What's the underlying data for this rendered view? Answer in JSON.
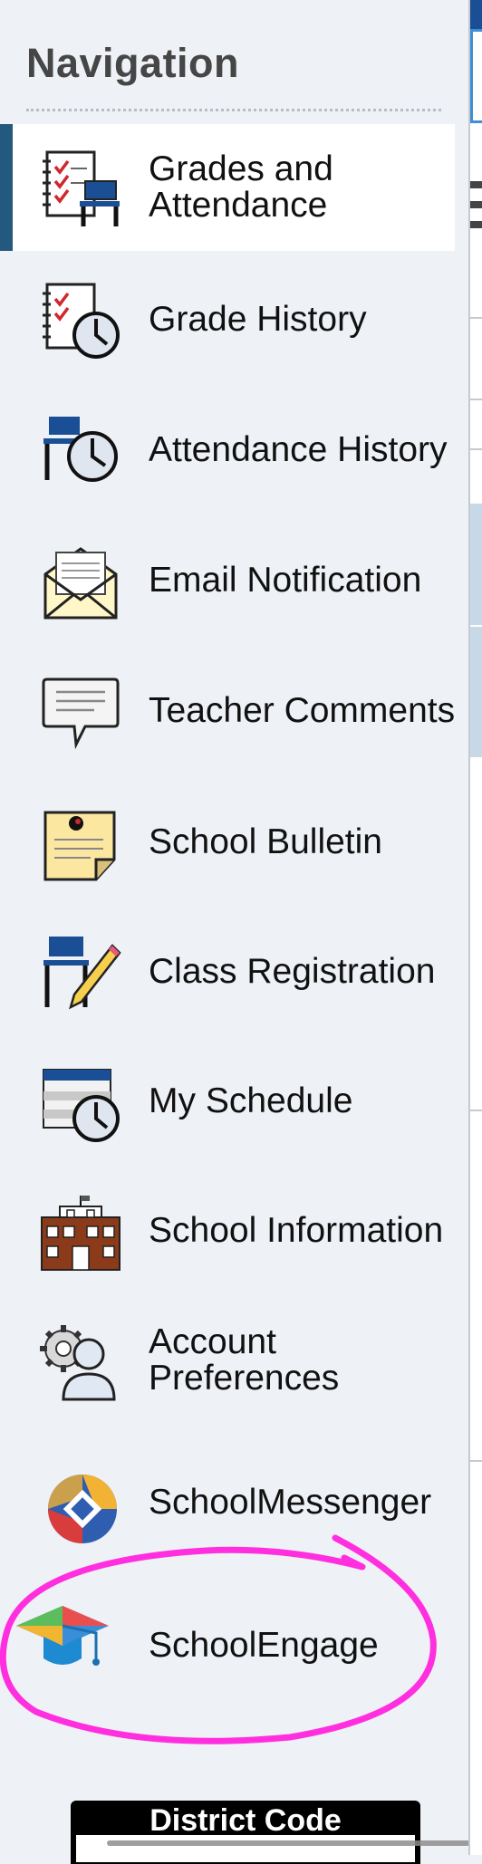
{
  "nav": {
    "title": "Navigation",
    "items": [
      {
        "label": "Grades and Attendance",
        "icon": "grades-checklist-icon"
      },
      {
        "label": "Grade History",
        "icon": "grade-history-icon"
      },
      {
        "label": "Attendance History",
        "icon": "attendance-history-icon"
      },
      {
        "label": "Email Notification",
        "icon": "email-envelope-icon"
      },
      {
        "label": "Teacher Comments",
        "icon": "speech-bubble-icon"
      },
      {
        "label": "School Bulletin",
        "icon": "bulletin-note-icon"
      },
      {
        "label": "Class Registration",
        "icon": "class-registration-icon"
      },
      {
        "label": "My Schedule",
        "icon": "schedule-calendar-icon"
      },
      {
        "label": "School Information",
        "icon": "school-building-icon"
      },
      {
        "label": "Account Preferences",
        "icon": "account-gear-icon"
      },
      {
        "label": "SchoolMessenger",
        "icon": "schoolmessenger-logo-icon"
      },
      {
        "label": "SchoolEngage",
        "icon": "graduation-cap-icon"
      }
    ],
    "active_index": 0
  },
  "footer": {
    "district_code_label": "District Code"
  },
  "colors": {
    "panel_bg": "#eef1f6",
    "active_bar": "#24597f",
    "annotation": "#ff2fe0",
    "icon_blue": "#1b4f95"
  }
}
